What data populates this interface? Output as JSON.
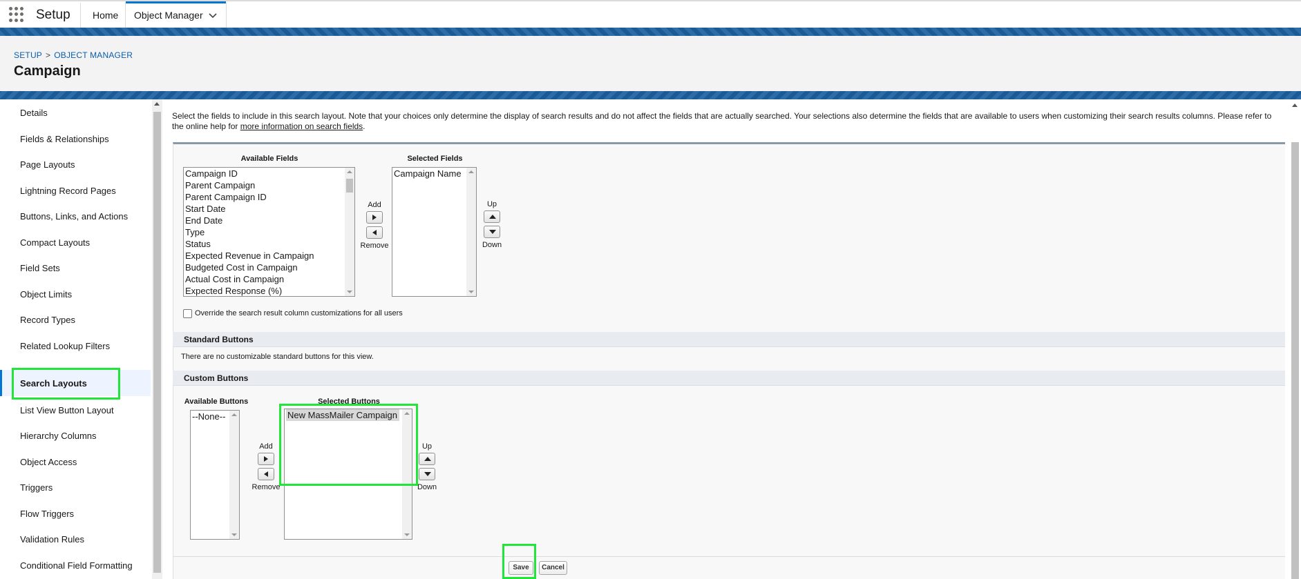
{
  "topnav": {
    "app_name": "Setup",
    "home_label": "Home",
    "tab_label": "Object Manager"
  },
  "header": {
    "breadcrumb": [
      "SETUP",
      "OBJECT MANAGER"
    ],
    "breadcrumb_sep": ">",
    "title": "Campaign"
  },
  "sidebar": {
    "items": [
      {
        "label": "Details"
      },
      {
        "label": "Fields & Relationships"
      },
      {
        "label": "Page Layouts"
      },
      {
        "label": "Lightning Record Pages"
      },
      {
        "label": "Buttons, Links, and Actions"
      },
      {
        "label": "Compact Layouts"
      },
      {
        "label": "Field Sets"
      },
      {
        "label": "Object Limits"
      },
      {
        "label": "Record Types"
      },
      {
        "label": "Related Lookup Filters"
      },
      {
        "label": "Search Layouts",
        "active": true
      },
      {
        "label": "List View Button Layout"
      },
      {
        "label": "Hierarchy Columns"
      },
      {
        "label": "Object Access"
      },
      {
        "label": "Triggers"
      },
      {
        "label": "Flow Triggers"
      },
      {
        "label": "Validation Rules"
      },
      {
        "label": "Conditional Field Formatting"
      }
    ]
  },
  "main": {
    "intro_text": "Select the fields to include in this search layout. Note that your choices only determine the display of search results and do not affect the fields that are actually searched. Your selections also determine the fields that are available to users when customizing their search results columns. Please refer to the online help for ",
    "intro_link": "more information on search fields",
    "intro_end": ".",
    "fields": {
      "available_label": "Available Fields",
      "selected_label": "Selected Fields",
      "available": [
        "Campaign ID",
        "Parent Campaign",
        "Parent Campaign ID",
        "Start Date",
        "End Date",
        "Type",
        "Status",
        "Expected Revenue in Campaign",
        "Budgeted Cost in Campaign",
        "Actual Cost in Campaign",
        "Expected Response (%)"
      ],
      "selected": [
        "Campaign Name"
      ],
      "add_label": "Add",
      "remove_label": "Remove",
      "up_label": "Up",
      "down_label": "Down"
    },
    "override_label": "Override the search result column customizations for all users",
    "standard_buttons": {
      "title": "Standard Buttons",
      "note": "There are no customizable standard buttons for this view."
    },
    "custom_buttons": {
      "title": "Custom Buttons",
      "available_label": "Available Buttons",
      "selected_label": "Selected Buttons",
      "available": [
        "--None--"
      ],
      "selected": [
        "New MassMailer Campaign"
      ],
      "add_label": "Add",
      "remove_label": "Remove",
      "up_label": "Up",
      "down_label": "Down"
    },
    "save_label": "Save",
    "cancel_label": "Cancel"
  },
  "highlight_color": "#22e53a",
  "accent_color": "#0176d3"
}
